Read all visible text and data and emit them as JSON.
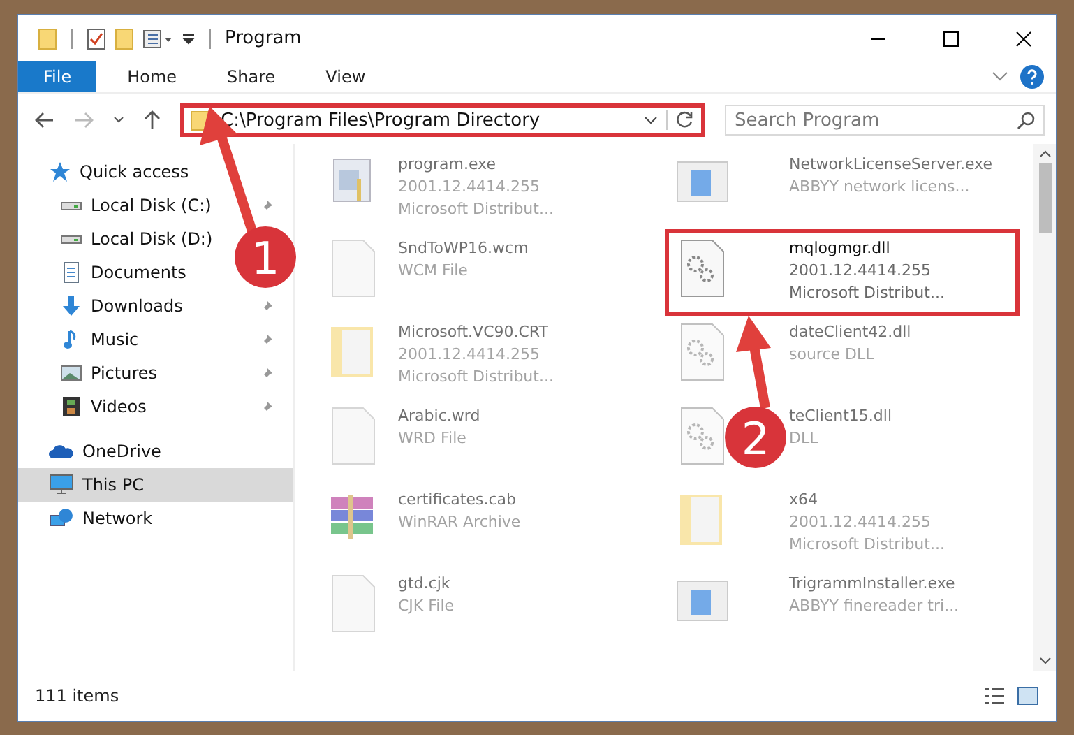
{
  "window": {
    "title": "Program"
  },
  "ribbon": {
    "tabs": [
      {
        "label": "File",
        "selected": true
      },
      {
        "label": "Home",
        "selected": false
      },
      {
        "label": "Share",
        "selected": false
      },
      {
        "label": "View",
        "selected": false
      }
    ]
  },
  "address_bar": {
    "path": "C:\\Program Files\\Program Directory",
    "highlighted": true
  },
  "search": {
    "placeholder": "Search Program"
  },
  "sidebar": {
    "items": [
      {
        "label": "Quick access",
        "kind": "star",
        "pinned": false,
        "selected": false,
        "children": [
          {
            "label": "Local Disk (C:)",
            "kind": "disk",
            "pinned": true
          },
          {
            "label": "Local Disk (D:)",
            "kind": "disk",
            "pinned": false
          },
          {
            "label": "Documents",
            "kind": "doc",
            "pinned": false
          },
          {
            "label": "Downloads",
            "kind": "download",
            "pinned": true
          },
          {
            "label": "Music",
            "kind": "music",
            "pinned": true
          },
          {
            "label": "Pictures",
            "kind": "picture",
            "pinned": true
          },
          {
            "label": "Videos",
            "kind": "video",
            "pinned": true
          }
        ]
      },
      {
        "label": "OneDrive",
        "kind": "cloud",
        "pinned": false,
        "selected": false
      },
      {
        "label": "This PC",
        "kind": "pc",
        "pinned": false,
        "selected": true
      },
      {
        "label": "Network",
        "kind": "network",
        "pinned": false,
        "selected": false
      }
    ]
  },
  "files": [
    {
      "name": "program.exe",
      "lines": [
        "2001.12.4414.255",
        "Microsoft Distribut..."
      ],
      "kind": "exe",
      "faded": true,
      "highlighted": false
    },
    {
      "name": "NetworkLicenseServer.exe",
      "lines": [
        "ABBYY network licens..."
      ],
      "kind": "app",
      "faded": true,
      "highlighted": false
    },
    {
      "name": "SndToWP16.wcm",
      "lines": [
        "WCM File"
      ],
      "kind": "blank",
      "faded": true,
      "highlighted": false
    },
    {
      "name": "mqlogmgr.dll",
      "lines": [
        "2001.12.4414.255",
        "Microsoft Distribut..."
      ],
      "kind": "dll",
      "faded": false,
      "highlighted": true
    },
    {
      "name": "Microsoft.VC90.CRT",
      "lines": [
        "2001.12.4414.255",
        "Microsoft Distribut..."
      ],
      "kind": "folder",
      "faded": true,
      "highlighted": false
    },
    {
      "name": "dateClient42.dll",
      "lines": [
        "source DLL"
      ],
      "kind": "dll",
      "faded": true,
      "highlighted": false
    },
    {
      "name": "Arabic.wrd",
      "lines": [
        "WRD File"
      ],
      "kind": "blank",
      "faded": true,
      "highlighted": false
    },
    {
      "name": "teClient15.dll",
      "lines": [
        "DLL"
      ],
      "kind": "dll",
      "faded": true,
      "highlighted": false
    },
    {
      "name": "certificates.cab",
      "lines": [
        "WinRAR Archive"
      ],
      "kind": "archive",
      "faded": true,
      "highlighted": false
    },
    {
      "name": "x64",
      "lines": [
        "2001.12.4414.255",
        "Microsoft Distribut..."
      ],
      "kind": "folder",
      "faded": true,
      "highlighted": false
    },
    {
      "name": "gtd.cjk",
      "lines": [
        "CJK File"
      ],
      "kind": "blank",
      "faded": true,
      "highlighted": false
    },
    {
      "name": "TrigrammInstaller.exe",
      "lines": [
        "ABBYY finereader tri..."
      ],
      "kind": "app",
      "faded": true,
      "highlighted": false
    }
  ],
  "status_bar": {
    "count": "111 items"
  },
  "annotations": [
    {
      "label": "1"
    },
    {
      "label": "2"
    }
  ]
}
